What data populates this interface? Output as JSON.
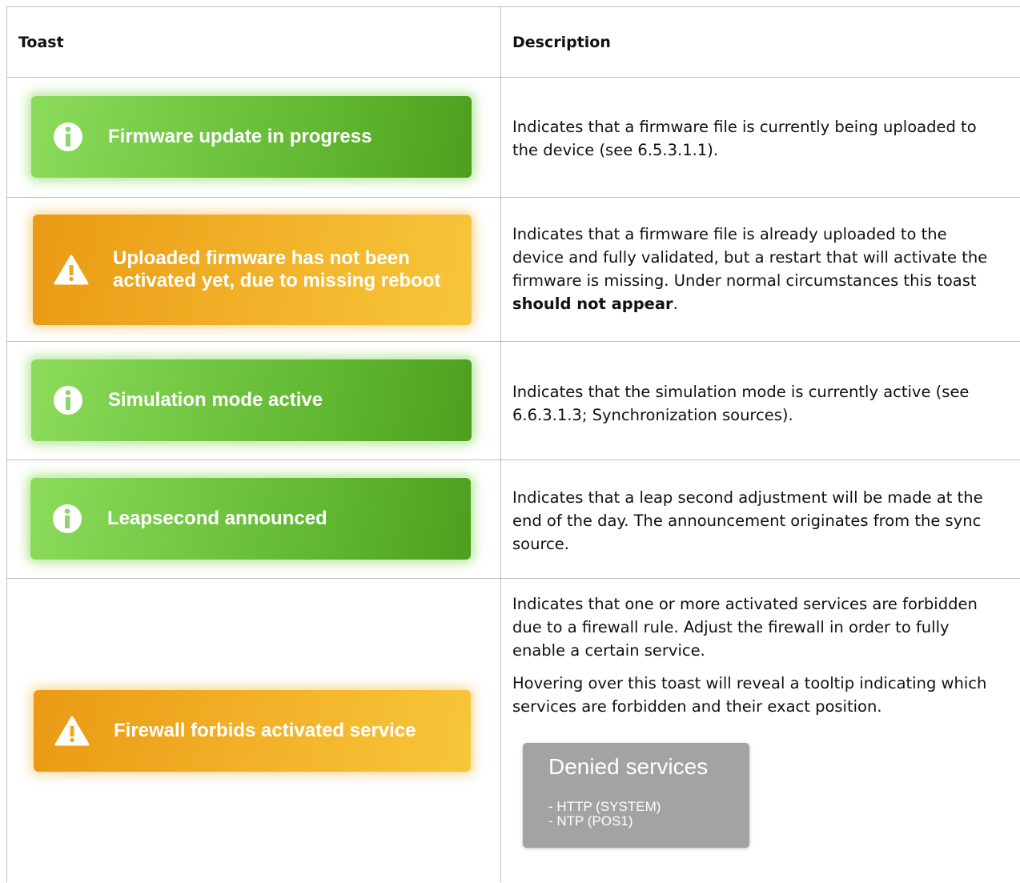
{
  "header": {
    "col_toast": "Toast",
    "col_description": "Description"
  },
  "rows": [
    {
      "toast": {
        "text": "Firmware update in progress",
        "kind": "info",
        "color": "#5eb52e",
        "icon": "info-circle-icon"
      },
      "description": [
        "Indicates that a firmware file is currently being uploaded to the device (see 6.5.3.1.1)."
      ]
    },
    {
      "toast": {
        "text": "Uploaded firmware has not been activated yet, due to missing reboot",
        "kind": "warning",
        "color": "#f3b52b",
        "icon": "warning-triangle-icon"
      },
      "description_pre": "Indicates that a firmware file is already uploaded to the device and fully validated, but a restart that will activate the firmware is missing. Under normal circumstances this toast ",
      "description_bold": "should not appear",
      "description_post": "."
    },
    {
      "toast": {
        "text": "Simulation mode active",
        "kind": "info",
        "color": "#5eb52e",
        "icon": "info-circle-icon"
      },
      "description": [
        "Indicates that the simulation mode is currently active (see 6.6.3.1.3; Synchronization sources)."
      ]
    },
    {
      "toast": {
        "text": "Leapsecond announced",
        "kind": "info",
        "color": "#5eb52e",
        "icon": "info-circle-icon"
      },
      "description": [
        "Indicates that a leap second adjustment will be made at the end of the day. The announcement originates from the sync source."
      ]
    },
    {
      "toast": {
        "text": "Firewall forbids activated service",
        "kind": "warning",
        "color": "#f3b52b",
        "icon": "warning-triangle-icon"
      },
      "description": [
        "Indicates that one or more activated services are forbidden due to a firewall rule. Adjust the firewall in order to fully enable a certain service.",
        "Hovering over this toast will reveal a tooltip indicating which services are forbidden and their exact position."
      ],
      "tooltip": {
        "title": "Denied services",
        "items": [
          "- HTTP (SYSTEM)",
          "- NTP (POS1)"
        ]
      }
    }
  ]
}
